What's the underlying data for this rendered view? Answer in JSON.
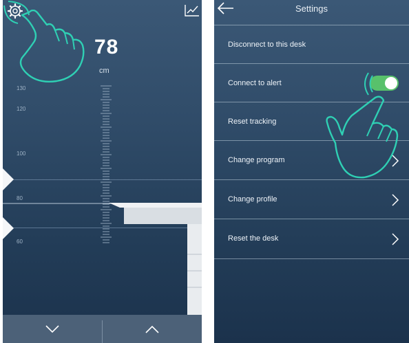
{
  "height_screen": {
    "height_value": "78",
    "height_unit": "cm",
    "tick_labels": [
      "130",
      "120",
      "100",
      "80",
      "60"
    ],
    "buttons": {
      "down": "chevron-down-icon",
      "up": "chevron-up-icon"
    },
    "icons": {
      "settings": "gear-icon",
      "history": "chart-icon"
    }
  },
  "settings_screen": {
    "title": "Settings",
    "back_icon": "arrow-left-icon",
    "items": [
      {
        "label": "Disconnect to this desk",
        "control": "none"
      },
      {
        "label": "Connect to alert",
        "control": "toggle",
        "toggle_on": true
      },
      {
        "label": "Reset tracking",
        "control": "none"
      },
      {
        "label": "Change program",
        "control": "chevron"
      },
      {
        "label": "Change profile",
        "control": "chevron"
      },
      {
        "label": "Reset the desk",
        "control": "chevron"
      }
    ]
  },
  "colors": {
    "background_top": "#3b5876",
    "background_bottom": "#1b324c",
    "accent_teal": "#2fd0b4",
    "toggle_on": "#58c16b",
    "text": "#ffffff"
  }
}
